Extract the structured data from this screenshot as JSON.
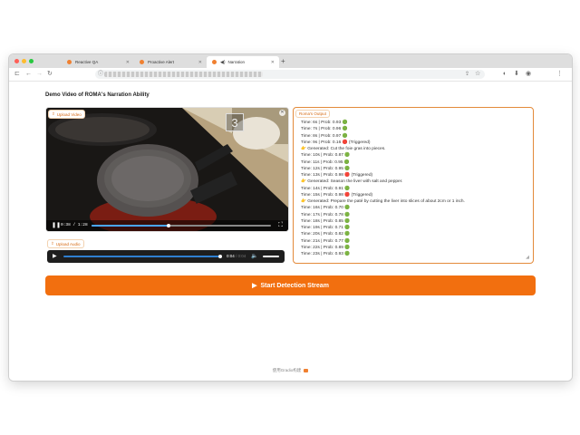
{
  "browser": {
    "tabs": [
      {
        "label": "Reactive QA"
      },
      {
        "label": "Proactive Alert"
      },
      {
        "label": "Narration"
      }
    ],
    "new_tab": "+",
    "colors": {
      "close": "#ff5f57",
      "minimize": "#febc2e",
      "maximize": "#28c840"
    }
  },
  "page": {
    "title": "Demo Video of ROMA's Narration Ability"
  },
  "video": {
    "upload_label": "Upload Video",
    "overlay_number": "3",
    "time": "0:38 / 1:28",
    "progress": 0.43
  },
  "audio": {
    "upload_label": "Upload Audio",
    "current": "0:04",
    "total": "/ 0:04",
    "progress": 1.0
  },
  "output": {
    "label": "Roma's Output",
    "lines": [
      "Time: 6s | Prob: 0.93 🟢",
      "Time: 7s | Prob: 0.96 🟢",
      "Time: 8s | Prob: 0.97 🟢",
      "Time: 9s | Prob: 0.16 🔴 (Triggered)",
      "👉 Generated: Cut the foie gras into pieces.",
      "Time: 10s | Prob: 0.87 🟢",
      "Time: 11s | Prob: 0.95 🟢",
      "Time: 12s | Prob: 0.95 🟢",
      "Time: 13s | Prob: 0.98 🔴 (Triggered)",
      "👉 Generated: Season the liver with salt and pepper.",
      "Time: 14s | Prob: 0.91 🟢",
      "Time: 15s | Prob: 0.98 🔴 (Triggered)",
      "👉 Generated: Prepare the paté by cutting the liver into slices of about 2cm or 1 inch.",
      "Time: 16s | Prob: 0.70 🟢",
      "Time: 17s | Prob: 0.78 🟢",
      "Time: 18s | Prob: 0.85 🟢",
      "Time: 19s | Prob: 0.71 🟢",
      "Time: 20s | Prob: 0.82 🟢",
      "Time: 21s | Prob: 0.77 🟢",
      "Time: 22s | Prob: 0.89 🟢",
      "Time: 23s | Prob: 0.93 🟢"
    ]
  },
  "action": {
    "start_label": "Start Detection Stream",
    "icon": "▶"
  },
  "footer": {
    "text": "使用Gradio构建"
  },
  "accent": "#f26f0f"
}
